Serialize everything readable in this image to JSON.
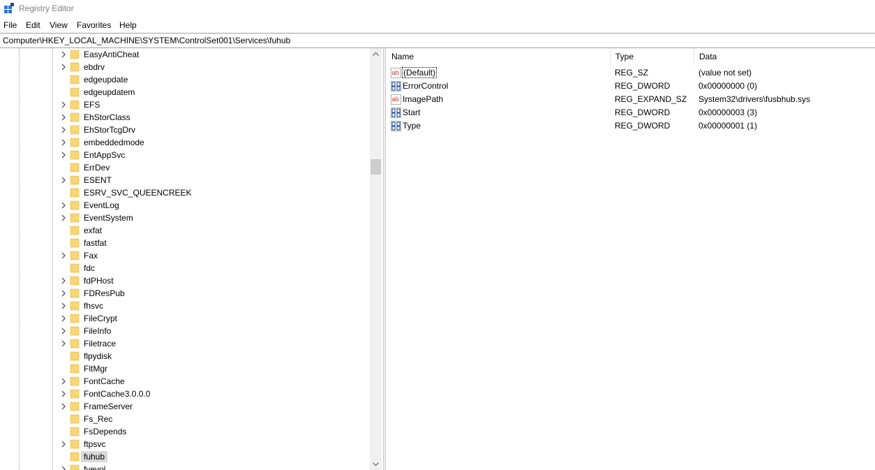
{
  "window": {
    "title": "Registry Editor",
    "icon": "registry-editor-icon"
  },
  "menu": [
    "File",
    "Edit",
    "View",
    "Favorites",
    "Help"
  ],
  "address": "Computer\\HKEY_LOCAL_MACHINE\\SYSTEM\\ControlSet001\\Services\\fuhub",
  "tree": {
    "selected": "fuhub",
    "items": [
      {
        "label": "EasyAntiCheat",
        "expandable": true
      },
      {
        "label": "ebdrv",
        "expandable": true
      },
      {
        "label": "edgeupdate",
        "expandable": false
      },
      {
        "label": "edgeupdatem",
        "expandable": false
      },
      {
        "label": "EFS",
        "expandable": true
      },
      {
        "label": "EhStorClass",
        "expandable": true
      },
      {
        "label": "EhStorTcgDrv",
        "expandable": true
      },
      {
        "label": "embeddedmode",
        "expandable": true
      },
      {
        "label": "EntAppSvc",
        "expandable": true
      },
      {
        "label": "ErrDev",
        "expandable": false
      },
      {
        "label": "ESENT",
        "expandable": true
      },
      {
        "label": "ESRV_SVC_QUEENCREEK",
        "expandable": false
      },
      {
        "label": "EventLog",
        "expandable": true
      },
      {
        "label": "EventSystem",
        "expandable": true
      },
      {
        "label": "exfat",
        "expandable": false
      },
      {
        "label": "fastfat",
        "expandable": false
      },
      {
        "label": "Fax",
        "expandable": true
      },
      {
        "label": "fdc",
        "expandable": false
      },
      {
        "label": "fdPHost",
        "expandable": true
      },
      {
        "label": "FDResPub",
        "expandable": true
      },
      {
        "label": "fhsvc",
        "expandable": true
      },
      {
        "label": "FileCrypt",
        "expandable": true
      },
      {
        "label": "FileInfo",
        "expandable": true
      },
      {
        "label": "Filetrace",
        "expandable": true
      },
      {
        "label": "flpydisk",
        "expandable": false
      },
      {
        "label": "FltMgr",
        "expandable": false
      },
      {
        "label": "FontCache",
        "expandable": true
      },
      {
        "label": "FontCache3.0.0.0",
        "expandable": true
      },
      {
        "label": "FrameServer",
        "expandable": true
      },
      {
        "label": "Fs_Rec",
        "expandable": false
      },
      {
        "label": "FsDepends",
        "expandable": false
      },
      {
        "label": "ftpsvc",
        "expandable": true
      },
      {
        "label": "fuhub",
        "expandable": false
      },
      {
        "label": "fvevol",
        "expandable": true
      }
    ]
  },
  "list": {
    "columns": [
      "Name",
      "Type",
      "Data"
    ],
    "values": [
      {
        "name": "(Default)",
        "type": "REG_SZ",
        "data": "(value not set)",
        "icon": "string-value-icon"
      },
      {
        "name": "ErrorControl",
        "type": "REG_DWORD",
        "data": "0x00000000 (0)",
        "icon": "binary-value-icon"
      },
      {
        "name": "ImagePath",
        "type": "REG_EXPAND_SZ",
        "data": "System32\\drivers\\fusbhub.sys",
        "icon": "string-value-icon"
      },
      {
        "name": "Start",
        "type": "REG_DWORD",
        "data": "0x00000003 (3)",
        "icon": "binary-value-icon"
      },
      {
        "name": "Type",
        "type": "REG_DWORD",
        "data": "0x00000001 (1)",
        "icon": "binary-value-icon"
      }
    ]
  },
  "colors": {
    "folder": "#f8d675",
    "folder_edge": "#dcb64a",
    "string_icon": "#c0392b",
    "binary_icon": "#1f4f9a",
    "selection": "#d9d9d9"
  }
}
